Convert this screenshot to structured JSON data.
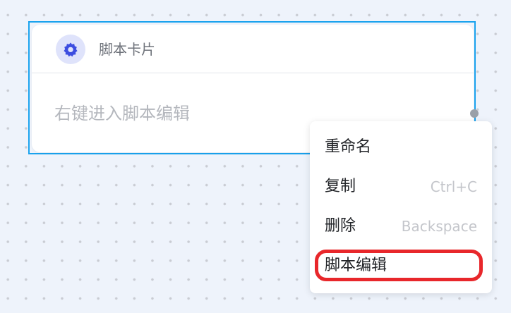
{
  "node": {
    "icon": "gear-icon",
    "title": "脚本卡片",
    "body_text": "右键进入脚本编辑",
    "selection_color": "#1aa3ee",
    "icon_color": "#3c4de0"
  },
  "context_menu": {
    "items": [
      {
        "label": "重命名",
        "shortcut": ""
      },
      {
        "label": "复制",
        "shortcut": "Ctrl+C"
      },
      {
        "label": "删除",
        "shortcut": "Backspace"
      },
      {
        "label": "脚本编辑",
        "shortcut": ""
      }
    ],
    "highlight_color": "#e8272b"
  }
}
